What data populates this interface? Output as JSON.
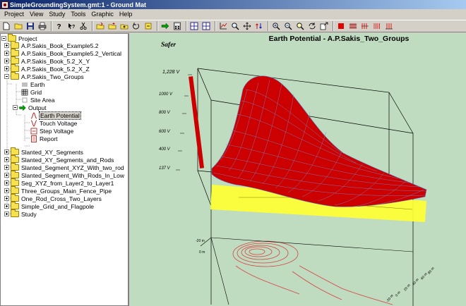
{
  "window": {
    "title": "SimpleGroundingSystem.gmt:1 - Ground Mat"
  },
  "menu": [
    "Project",
    "View",
    "Study",
    "Tools",
    "Graphic",
    "Help"
  ],
  "tree": {
    "root": "Project",
    "items": [
      {
        "label": "A.P.Sakis_Book_Example5.2"
      },
      {
        "label": "A.P.Sakis_Book_Example5.2_Vertical"
      },
      {
        "label": "A.P.Sakis_Book_5.2_X_Y"
      },
      {
        "label": "A.P.Sakis_Book_5.2_X_Z"
      },
      {
        "label": "A.P.Sakis_Two_Groups"
      },
      {
        "label": "Earth"
      },
      {
        "label": "Grid"
      },
      {
        "label": "Site Area"
      },
      {
        "label": "Output"
      },
      {
        "label": "Earth Potential"
      },
      {
        "label": "Touch Voltage"
      },
      {
        "label": "Step Voltage"
      },
      {
        "label": "Report"
      },
      {
        "label": "Slanted_XY_Segments"
      },
      {
        "label": "Slanted_XY_Segments_and_Rods"
      },
      {
        "label": "Slanted_Segment_XYZ_With_two_rod"
      },
      {
        "label": "Slanted_Segment_With_Rods_In_Low"
      },
      {
        "label": "Seg_XYZ_from_Layer2_to_Layer1"
      },
      {
        "label": "Three_Groups_Main_Fence_Pipe"
      },
      {
        "label": "One_Rod_Cross_Two_Layers"
      },
      {
        "label": "Simple_Grid_and_Flagpole"
      },
      {
        "label": "Study"
      }
    ]
  },
  "graphic": {
    "brand": "Safer",
    "colors": {
      "background": "#c0dcc0",
      "surface": "#cc0000",
      "plane": "#ffff33"
    }
  },
  "chart_data": {
    "type": "surface",
    "title": "Earth Potential - A.P.Sakis_Two_Groups",
    "z_ticks": [
      "1,228 V",
      "1000 V",
      "800 V",
      "600 V",
      "400 V",
      "137 V"
    ],
    "zlim": [
      137,
      1228
    ],
    "peak_value": 1228
  }
}
